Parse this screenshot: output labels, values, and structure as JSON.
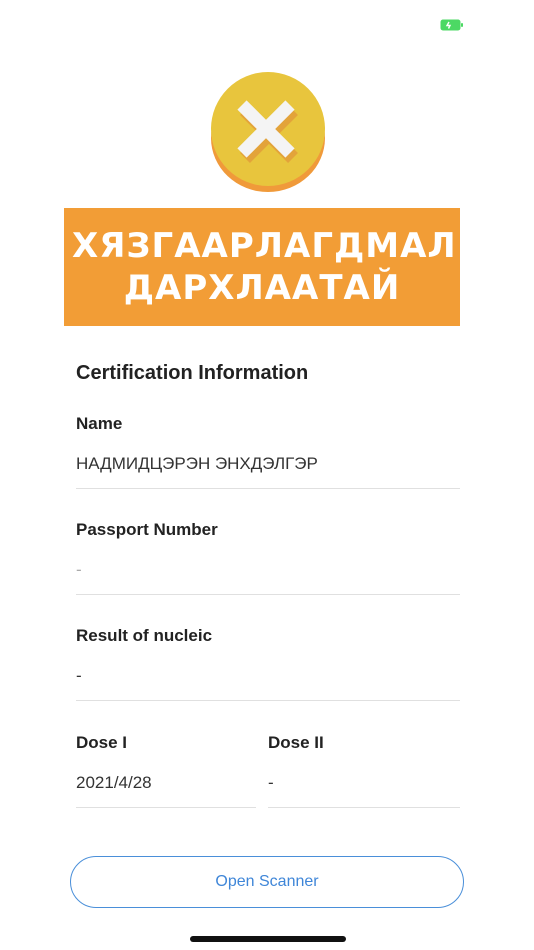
{
  "colors": {
    "banner": "#f29d36",
    "coin_face": "#e8c53d",
    "coin_edge": "#f09a3a",
    "button_accent": "#4a8fd9",
    "battery": "#4cd964"
  },
  "icons": {
    "battery": "battery-icon",
    "status": "x-mark-coin-icon"
  },
  "banner": {
    "text": "ХЯЗГААРЛАГДМАЛ ДАРХЛААТАЙ"
  },
  "certification": {
    "title": "Certification Information",
    "name_label": "Name",
    "name_value": "НАДМИДЦЭРЭН ЭНХДЭЛГЭР",
    "passport_label": "Passport Number",
    "passport_value": "-",
    "nucleic_label": "Result of nucleic",
    "nucleic_value": "-",
    "dose1_label": "Dose I",
    "dose1_value": "2021/4/28",
    "dose2_label": "Dose II",
    "dose2_value": "-"
  },
  "actions": {
    "open_scanner": "Open Scanner"
  }
}
